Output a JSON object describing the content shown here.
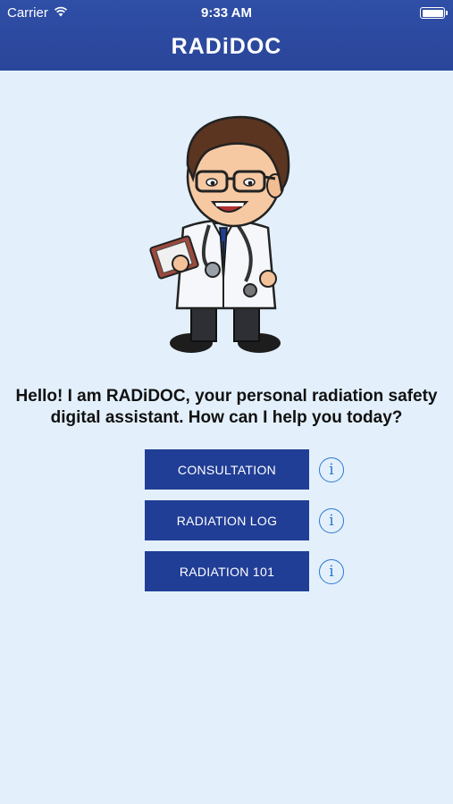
{
  "status_bar": {
    "carrier": "Carrier",
    "time": "9:33 AM"
  },
  "header": {
    "title": "RADiDOC",
    "color": "#2d4aa0"
  },
  "greeting": "Hello! I am RADiDOC, your personal radiation safety digital assistant. How can I help you today?",
  "menu": [
    {
      "label": "CONSULTATION",
      "info_icon": "i"
    },
    {
      "label": "RADIATION LOG",
      "info_icon": "i"
    },
    {
      "label": "RADIATION 101",
      "info_icon": "i"
    }
  ],
  "colors": {
    "background": "#e3f0fc",
    "button": "#213e96",
    "info": "#2c78d0"
  }
}
